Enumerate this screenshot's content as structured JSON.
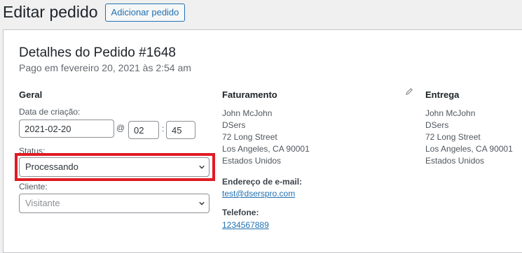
{
  "header": {
    "title": "Editar pedido",
    "add_button": "Adicionar pedido"
  },
  "order": {
    "title": "Detalhes do Pedido #1648",
    "subtitle": "Pago em fevereiro 20, 2021 às 2:54 am"
  },
  "general": {
    "heading": "Geral",
    "date_label": "Data de criação:",
    "date_value": "2021-02-20",
    "at": "@",
    "hour": "02",
    "colon": ":",
    "minute": "45",
    "status_label": "Status:",
    "status_value": "Processando",
    "customer_label": "Cliente:",
    "customer_placeholder": "Visitante"
  },
  "billing": {
    "heading": "Faturamento",
    "address": [
      "John McJohn",
      "DSers",
      "72 Long Street",
      "Los Angeles, CA 90001",
      "Estados Unidos"
    ],
    "email_label": "Endereço de e-mail:",
    "email": "test@dserspro.com",
    "phone_label": "Telefone:",
    "phone": "1234567889",
    "edit_icon": "pencil-icon"
  },
  "shipping": {
    "heading": "Entrega",
    "address": [
      "John McJohn",
      "DSers",
      "72 Long Street",
      "Los Angeles, CA 90001",
      "Estados Unidos"
    ]
  },
  "colors": {
    "accent": "#2271b1",
    "highlight": "#e01b24"
  }
}
